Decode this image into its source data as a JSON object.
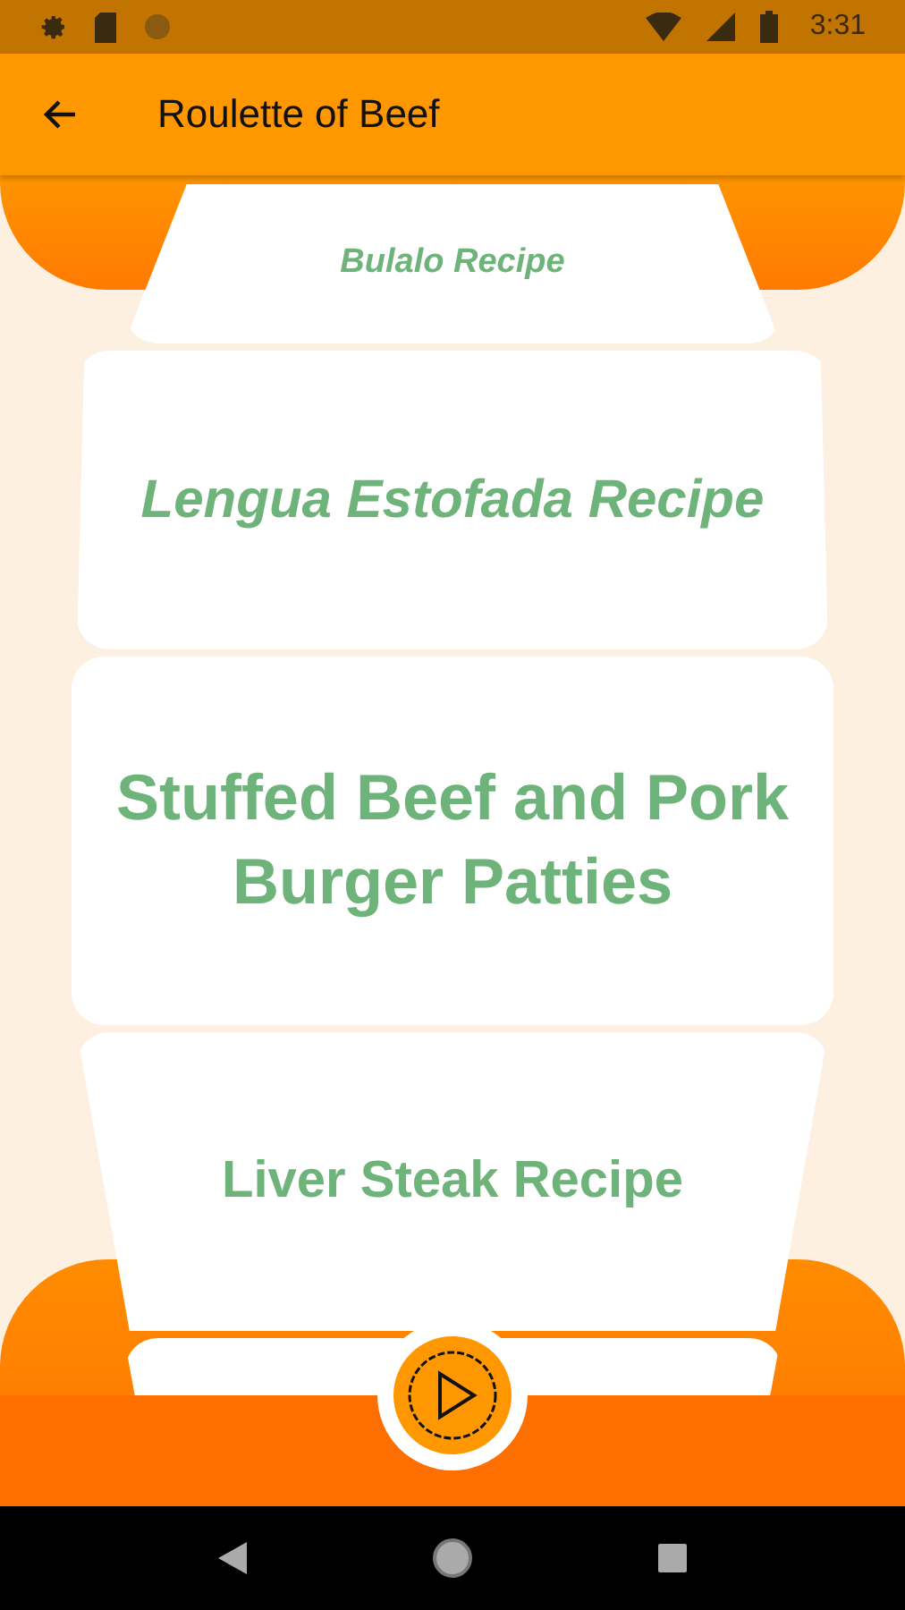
{
  "status_bar": {
    "time": "3:31"
  },
  "app_bar": {
    "title": "Roulette of Beef"
  },
  "recipes": [
    {
      "label": "Bulalo Recipe",
      "kind": "far-top"
    },
    {
      "label": "Lengua Estofada Recipe",
      "kind": "near-top"
    },
    {
      "label": "Stuffed Beef and Pork Burger Patties",
      "kind": "center"
    },
    {
      "label": "Liver Steak Recipe",
      "kind": "near-bottom"
    },
    {
      "kind": "edge-bottom"
    }
  ]
}
